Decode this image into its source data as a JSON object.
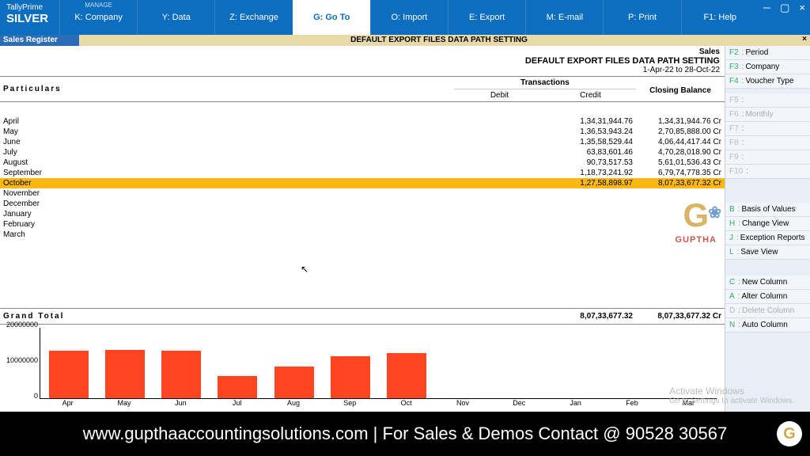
{
  "titlebar": {
    "product_line1": "TallyPrime",
    "product_line2": "SILVER",
    "manage": "MANAGE",
    "menu": [
      {
        "label": "K: Company"
      },
      {
        "label": "Y: Data"
      },
      {
        "label": "Z: Exchange"
      },
      {
        "label": "G: Go To",
        "active": true
      },
      {
        "label": "O: Import"
      },
      {
        "label": "E: Export"
      },
      {
        "label": "M: E-mail"
      },
      {
        "label": "P: Print"
      },
      {
        "label": "F1: Help"
      }
    ]
  },
  "subheader": {
    "left": "Sales Register",
    "center": "DEFAULT EXPORT FILES  DATA PATH SETTING",
    "close": "×"
  },
  "report": {
    "title": "Sales",
    "company": "DEFAULT EXPORT FILES  DATA PATH SETTING",
    "period": "1-Apr-22 to 28-Oct-22",
    "particulars_label": "Particulars",
    "transactions_label": "Transactions",
    "debit_label": "Debit",
    "credit_label": "Credit",
    "closing_label": "Closing Balance",
    "grand_total_label": "Grand Total",
    "grand_total_credit": "8,07,33,677.32",
    "grand_total_balance": "8,07,33,677.32 Cr"
  },
  "rows": [
    {
      "month": "April",
      "credit": "1,34,31,944.76",
      "balance": "1,34,31,944.76 Cr"
    },
    {
      "month": "May",
      "credit": "1,36,53,943.24",
      "balance": "2,70,85,888.00 Cr"
    },
    {
      "month": "June",
      "credit": "1,35,58,529.44",
      "balance": "4,06,44,417.44 Cr"
    },
    {
      "month": "July",
      "credit": "63,83,601.46",
      "balance": "4,70,28,018.90 Cr"
    },
    {
      "month": "August",
      "credit": "90,73,517.53",
      "balance": "5,61,01,536.43 Cr"
    },
    {
      "month": "September",
      "credit": "1,18,73,241.92",
      "balance": "6,79,74,778.35 Cr"
    },
    {
      "month": "October",
      "credit": "1,27,58,898.97",
      "balance": "8,07,33,677.32 Cr",
      "selected": true
    },
    {
      "month": "November",
      "credit": "",
      "balance": ""
    },
    {
      "month": "December",
      "credit": "",
      "balance": ""
    },
    {
      "month": "January",
      "credit": "",
      "balance": ""
    },
    {
      "month": "February",
      "credit": "",
      "balance": ""
    },
    {
      "month": "March",
      "credit": "",
      "balance": ""
    }
  ],
  "watermark": {
    "g": "G",
    "brand": "GUPTHA"
  },
  "chart_data": {
    "type": "bar",
    "categories": [
      "Apr",
      "May",
      "Jun",
      "Jul",
      "Aug",
      "Sep",
      "Oct",
      "Nov",
      "Dec",
      "Jan",
      "Feb",
      "Mar"
    ],
    "values": [
      13431944,
      13653943,
      13558529,
      6383601,
      9073517,
      11873241,
      12758898,
      0,
      0,
      0,
      0,
      0
    ],
    "ylim": [
      0,
      20000000
    ],
    "yticks": [
      0,
      10000000,
      20000000
    ],
    "ylabel": "",
    "xlabel": "",
    "title": ""
  },
  "sidebar": {
    "items": [
      {
        "key": "F2",
        "label": "Period"
      },
      {
        "key": "F3",
        "label": "Company"
      },
      {
        "key": "F4",
        "label": "Voucher Type"
      }
    ],
    "items2": [
      {
        "key": "F5",
        "label": "",
        "disabled": true
      },
      {
        "key": "F6",
        "label": "Monthly",
        "disabled": true
      },
      {
        "key": "F7",
        "label": "",
        "disabled": true
      },
      {
        "key": "F8",
        "label": "",
        "disabled": true
      },
      {
        "key": "F9",
        "label": "",
        "disabled": true
      },
      {
        "key": "F10",
        "label": "",
        "disabled": true
      }
    ],
    "items3": [
      {
        "key": "B",
        "label": "Basis of Values"
      },
      {
        "key": "H",
        "label": "Change View"
      },
      {
        "key": "J",
        "label": "Exception Reports"
      },
      {
        "key": "L",
        "label": "Save View"
      }
    ],
    "items4": [
      {
        "key": "C",
        "label": "New Column"
      },
      {
        "key": "A",
        "label": "Alter Column"
      },
      {
        "key": "D",
        "label": "Delete Column",
        "disabled": true
      },
      {
        "key": "N",
        "label": "Auto Column"
      }
    ]
  },
  "activate": {
    "line1": "Activate Windows",
    "line2": "Go to Settings to activate Windows."
  },
  "footer": {
    "text": "www.gupthaaccountingsolutions.com | For Sales & Demos Contact @ 90528 30567",
    "badge": "G"
  }
}
